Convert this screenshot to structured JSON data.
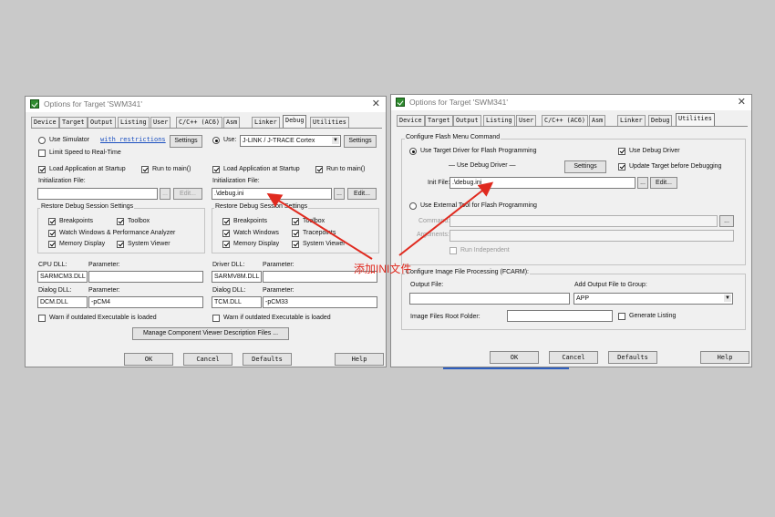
{
  "colors": {
    "annotation": "#e02a1f",
    "background": "#c9c9c9",
    "dialog": "#f0f0f0"
  },
  "left": {
    "title": "Options for Target 'SWM341'",
    "tabs": [
      "Device",
      "Target",
      "Output",
      "Listing",
      "User",
      "C/C++ (AC6)",
      "Asm",
      "Linker",
      "Debug",
      "Utilities"
    ],
    "active_tab": "Debug",
    "use_simulator": "Use Simulator",
    "with_restrictions": "with restrictions",
    "settings_sim": "Settings",
    "use_label": "Use:",
    "debugger": "J-LINK / J-TRACE Cortex",
    "settings_hw": "Settings",
    "limit_speed": "Limit Speed to Real-Time",
    "sim": {
      "load_app": "Load Application at Startup",
      "run_main": "Run to main()",
      "init_file_label": "Initialization File:",
      "init_file_value": "",
      "browse": "...",
      "edit": "Edit...",
      "restore_title": "Restore Debug Session Settings",
      "breakpoints": "Breakpoints",
      "toolbox": "Toolbox",
      "watch_windows": "Watch Windows & Performance Analyzer",
      "memory_display": "Memory Display",
      "system_viewer": "System Viewer",
      "cpu_dll_label": "CPU DLL:",
      "param_label": "Parameter:",
      "cpu_dll": "SARMCM3.DLL",
      "cpu_param": "",
      "dialog_dll_label": "Dialog DLL:",
      "dialog_dll": "DCM.DLL",
      "dialog_param": "-pCM4",
      "warn": "Warn if outdated Executable is loaded"
    },
    "hw": {
      "load_app": "Load Application at Startup",
      "run_main": "Run to main()",
      "init_file_label": "Initialization File:",
      "init_file_value": ".\\debug.ini",
      "browse": "...",
      "edit": "Edit...",
      "restore_title": "Restore Debug Session Settings",
      "breakpoints": "Breakpoints",
      "toolbox": "Toolbox",
      "watch_windows": "Watch Windows",
      "tracepoints": "Tracepoints",
      "memory_display": "Memory Display",
      "system_viewer": "System Viewer",
      "driver_dll_label": "Driver DLL:",
      "param_label": "Parameter:",
      "driver_dll": "SARMV8M.DLL",
      "driver_param": "",
      "dialog_dll_label": "Dialog DLL:",
      "dialog_dll": "TCM.DLL",
      "dialog_param": "-pCM33",
      "warn": "Warn if outdated Executable is loaded"
    },
    "manage": "Manage Component Viewer Description Files ...",
    "footer": {
      "ok": "OK",
      "cancel": "Cancel",
      "defaults": "Defaults",
      "help": "Help"
    }
  },
  "right": {
    "title": "Options for Target 'SWM341'",
    "tabs": [
      "Device",
      "Target",
      "Output",
      "Listing",
      "User",
      "C/C++ (AC6)",
      "Asm",
      "Linker",
      "Debug",
      "Utilities"
    ],
    "active_tab": "Utilities",
    "flash_group": "Configure Flash Menu Command",
    "use_target_driver": "Use Target Driver for Flash Programming",
    "use_debug_driver_chk": "Use Debug Driver",
    "use_debug_driver_sep": "— Use Debug Driver —",
    "settings": "Settings",
    "update_target": "Update Target before Debugging",
    "init_file_label": "Init File:",
    "init_file_value": ".\\debug.ini",
    "browse": "...",
    "edit": "Edit...",
    "use_external_tool": "Use External Tool for Flash Programming",
    "command_label": "Command:",
    "arguments_label": "Arguments:",
    "run_independent": "Run Independent",
    "image_group": "Configure Image File Processing (FCARM):",
    "output_file_label": "Output File:",
    "add_output_label": "Add Output File  to Group:",
    "group_value": "APP",
    "image_root_label": "Image Files Root Folder:",
    "generate_listing": "Generate Listing",
    "footer": {
      "ok": "OK",
      "cancel": "Cancel",
      "defaults": "Defaults",
      "help": "Help"
    }
  },
  "annotation": "添加INI文件"
}
